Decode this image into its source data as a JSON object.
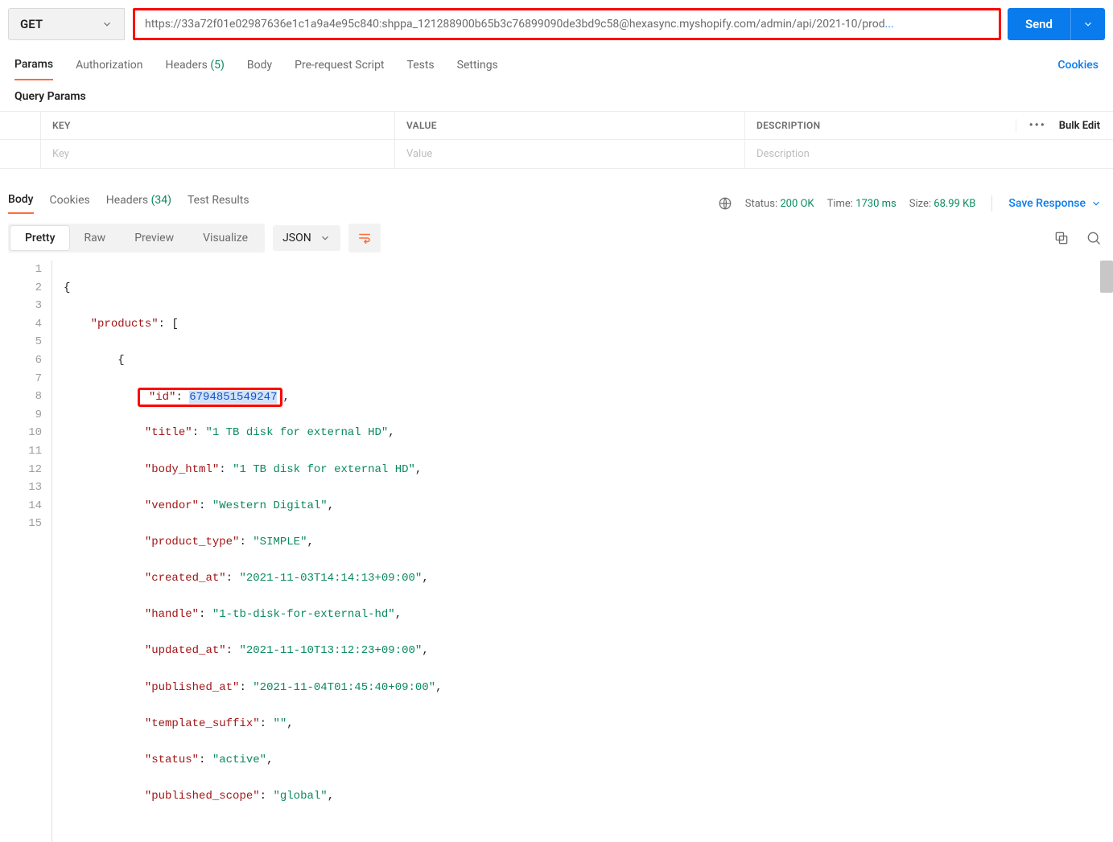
{
  "request": {
    "method": "GET",
    "url": "https://33a72f01e02987636e1c1a9a4e95c840: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@hexasync.myshopify.com/admin/api/2021-10/prod",
    "url_truncation": "...",
    "send_label": "Send"
  },
  "req_tabs": {
    "params": "Params",
    "authorization": "Authorization",
    "headers": "Headers",
    "headers_count": "(5)",
    "body": "Body",
    "prerequest": "Pre-request Script",
    "tests": "Tests",
    "settings": "Settings",
    "cookies": "Cookies"
  },
  "query_params": {
    "title": "Query Params",
    "key_header": "KEY",
    "value_header": "VALUE",
    "desc_header": "DESCRIPTION",
    "bulk_edit": "Bulk Edit",
    "key_placeholder": "Key",
    "value_placeholder": "Value",
    "desc_placeholder": "Description"
  },
  "resp_tabs": {
    "body": "Body",
    "cookies": "Cookies",
    "headers": "Headers",
    "headers_count": "(34)",
    "test_results": "Test Results"
  },
  "resp_meta": {
    "status_label": "Status:",
    "status_value": "200 OK",
    "time_label": "Time:",
    "time_value": "1730 ms",
    "size_label": "Size:",
    "size_value": "68.99 KB",
    "save_response": "Save Response"
  },
  "body_toolbar": {
    "pretty": "Pretty",
    "raw": "Raw",
    "preview": "Preview",
    "visualize": "Visualize",
    "lang": "JSON"
  },
  "json_body": {
    "products_key": "\"products\"",
    "id_key": "\"id\"",
    "id_value": "6794851549247",
    "title_key": "\"title\"",
    "title_value": "\"1 TB disk for external HD\"",
    "body_html_key": "\"body_html\"",
    "body_html_value": "\"1 TB disk for external HD\"",
    "vendor_key": "\"vendor\"",
    "vendor_value": "\"Western Digital\"",
    "product_type_key": "\"product_type\"",
    "product_type_value": "\"SIMPLE\"",
    "created_at_key": "\"created_at\"",
    "created_at_value": "\"2021-11-03T14:14:13+09:00\"",
    "handle_key": "\"handle\"",
    "handle_value": "\"1-tb-disk-for-external-hd\"",
    "updated_at_key": "\"updated_at\"",
    "updated_at_value": "\"2021-11-10T13:12:23+09:00\"",
    "published_at_key": "\"published_at\"",
    "published_at_value": "\"2021-11-04T01:45:40+09:00\"",
    "template_suffix_key": "\"template_suffix\"",
    "template_suffix_value": "\"\"",
    "status_key": "\"status\"",
    "status_value": "\"active\"",
    "published_scope_key": "\"published_scope\"",
    "published_scope_value": "\"global\""
  }
}
